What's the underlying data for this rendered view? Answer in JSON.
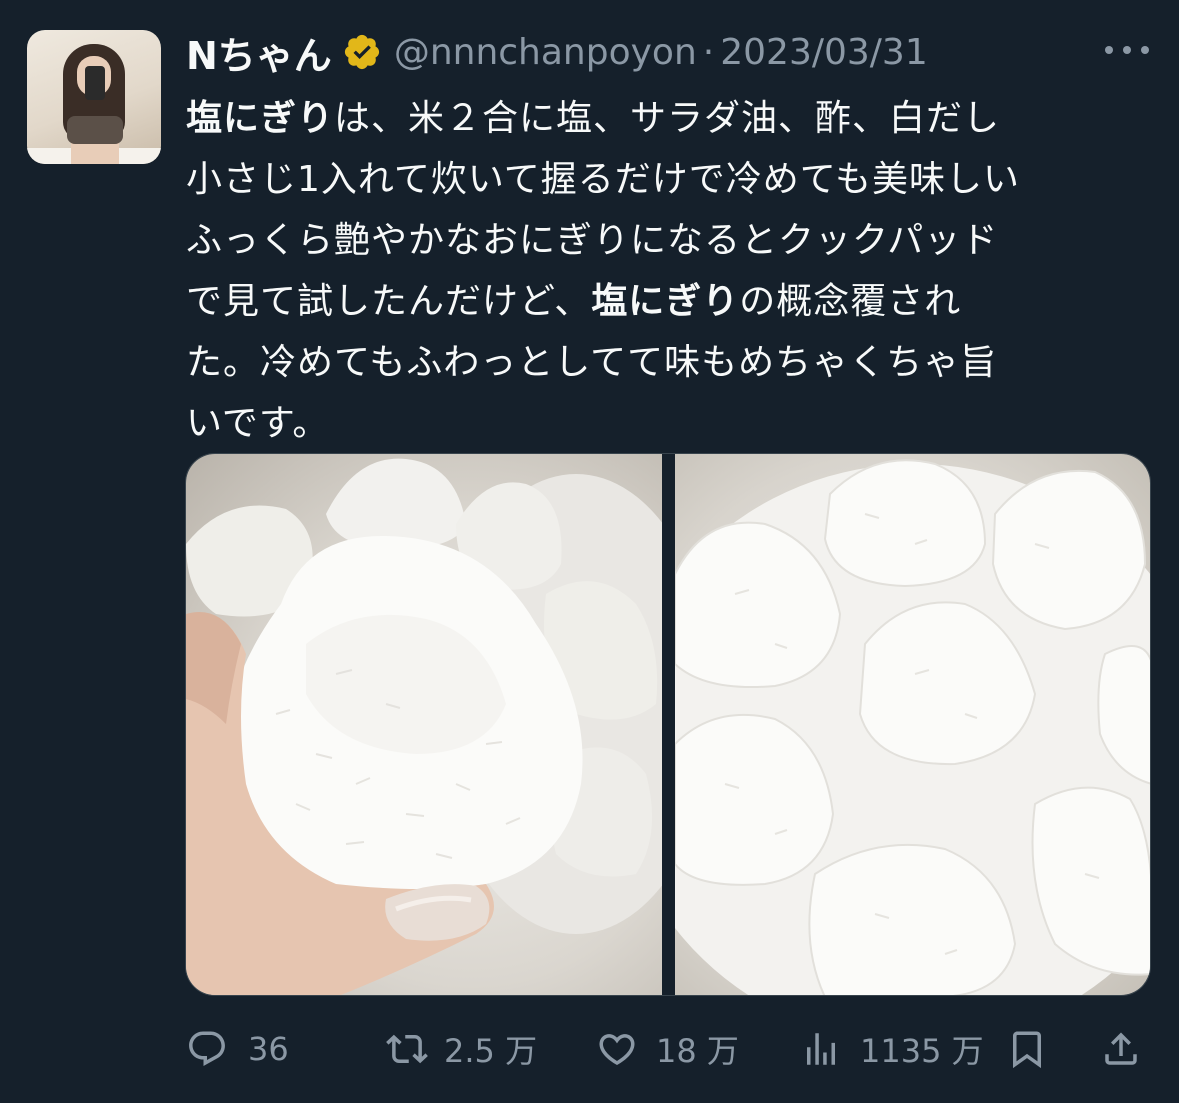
{
  "tweet": {
    "author_name": "Nちゃん",
    "handle": "@nnnchanpoyon",
    "separator": "·",
    "date": "2023/03/31",
    "body_lines": [
      [
        {
          "t": "塩にぎり",
          "b": true
        },
        {
          "t": "は、米２合に塩、サラダ油、酢、白だし",
          "b": false
        }
      ],
      [
        {
          "t": "小さじ1入れて炊いて握るだけで冷めても美味しい",
          "b": false
        }
      ],
      [
        {
          "t": "ふっくら艶やかなおにぎりになるとクックパッド",
          "b": false
        }
      ],
      [
        {
          "t": "で見て試したんだけど、",
          "b": false
        },
        {
          "t": "塩にぎり",
          "b": true
        },
        {
          "t": "の概念覆され",
          "b": false
        }
      ],
      [
        {
          "t": "た。冷めてもふわっとしてて味もめちゃくちゃ旨",
          "b": false
        }
      ],
      [
        {
          "t": "いです。",
          "b": false
        }
      ]
    ]
  },
  "icons": {
    "verified": "verified-badge-icon",
    "more": "more-options-icon",
    "reply": "reply-icon",
    "retweet": "retweet-icon",
    "like": "like-icon",
    "views": "views-icon",
    "bookmark": "bookmark-icon",
    "share": "share-icon"
  },
  "colors": {
    "background": "#15202b",
    "text": "#f7f9f9",
    "muted": "#8b98a5",
    "verified_gold": "#e2b719"
  },
  "actions": {
    "reply_count": "36",
    "retweet_count": "2.5 万",
    "like_count": "18 万",
    "views_count": "1135 万"
  }
}
